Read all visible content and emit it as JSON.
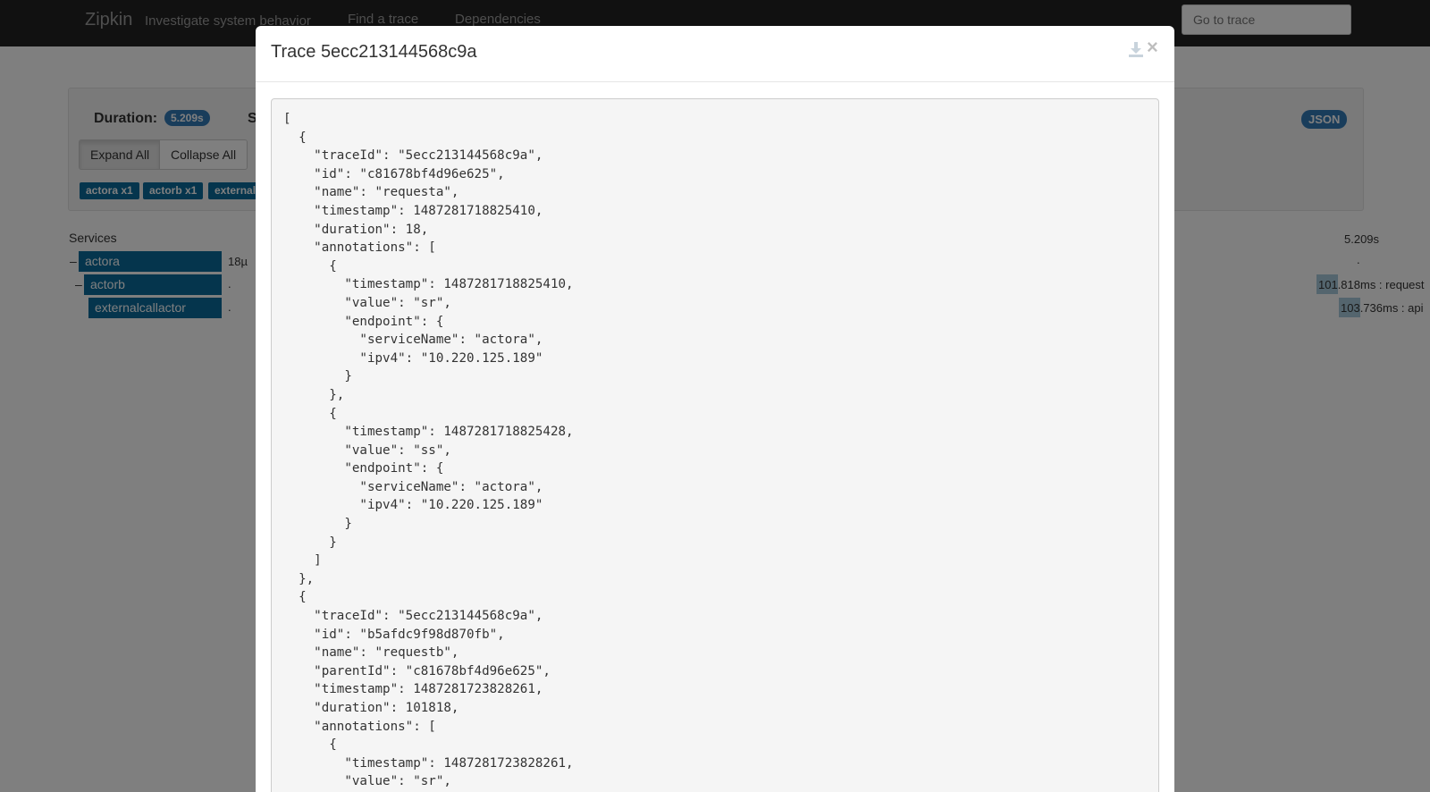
{
  "navbar": {
    "brand": "Zipkin",
    "tagline": "Investigate system behavior",
    "links": [
      "Find a trace",
      "Dependencies"
    ],
    "goto_placeholder": "Go to trace"
  },
  "summary": {
    "duration_label": "Duration:",
    "duration_value": "5.209s",
    "services_label_partial": "S",
    "json_button": "JSON",
    "expand_all": "Expand All",
    "collapse_all": "Collapse All",
    "service_badges": [
      "actora x1",
      "actorb x1",
      "external"
    ]
  },
  "timeline": {
    "services_header": "Services",
    "total_duration": "5.209s",
    "rows": [
      {
        "name": "actora",
        "toggle": "–",
        "mid_text": "18µ",
        "right_text": "."
      },
      {
        "name": "actorb",
        "toggle": "–",
        "mid_text": ".",
        "right_text": "101.818ms : request"
      },
      {
        "name": "externalcallactor",
        "toggle": "",
        "mid_text": ".",
        "right_text": "103.736ms : api"
      }
    ]
  },
  "modal": {
    "title": "Trace 5ecc213144568c9a",
    "download_icon": "download-icon",
    "close_symbol": "×",
    "json_text": "[\n  {\n    \"traceId\": \"5ecc213144568c9a\",\n    \"id\": \"c81678bf4d96e625\",\n    \"name\": \"requesta\",\n    \"timestamp\": 1487281718825410,\n    \"duration\": 18,\n    \"annotations\": [\n      {\n        \"timestamp\": 1487281718825410,\n        \"value\": \"sr\",\n        \"endpoint\": {\n          \"serviceName\": \"actora\",\n          \"ipv4\": \"10.220.125.189\"\n        }\n      },\n      {\n        \"timestamp\": 1487281718825428,\n        \"value\": \"ss\",\n        \"endpoint\": {\n          \"serviceName\": \"actora\",\n          \"ipv4\": \"10.220.125.189\"\n        }\n      }\n    ]\n  },\n  {\n    \"traceId\": \"5ecc213144568c9a\",\n    \"id\": \"b5afdc9f98d870fb\",\n    \"name\": \"requestb\",\n    \"parentId\": \"c81678bf4d96e625\",\n    \"timestamp\": 1487281723828261,\n    \"duration\": 101818,\n    \"annotations\": [\n      {\n        \"timestamp\": 1487281723828261,\n        \"value\": \"sr\","
  }
}
